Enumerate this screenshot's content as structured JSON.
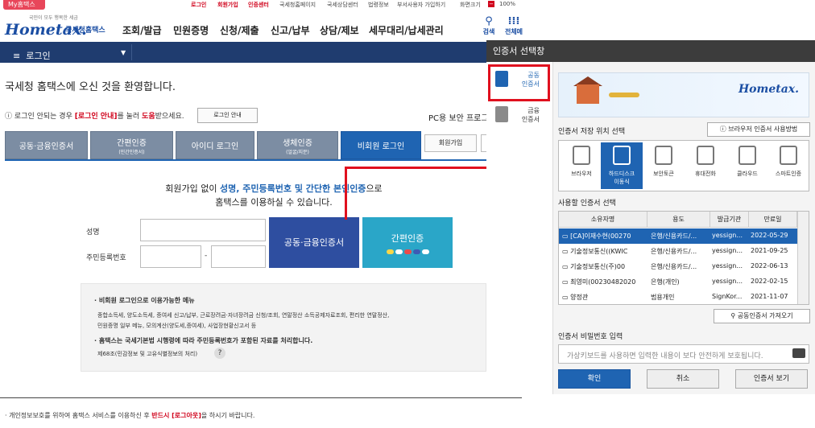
{
  "topbar": {
    "tab": "My홈택스",
    "links": [
      "로그인",
      "회원가입",
      "인증센터",
      "국세청홈페이지",
      "국세상담센터",
      "법령정보",
      "부서사용자 가입하기",
      "화면크기",
      "100%"
    ]
  },
  "header": {
    "logo_main": "Hometax.",
    "logo_sub": "국세청홈택스",
    "logo_tiny": "국민이 모두 행복한 세금",
    "menu": [
      "조회/발급",
      "민원증명",
      "신청/제출",
      "신고/납부",
      "상담/제보",
      "세무대리/납세관리"
    ],
    "search_label": "검색",
    "all_menu_label": "전체메"
  },
  "loginbar": {
    "label": "로그인"
  },
  "main": {
    "welcome": "국세청 홈택스에 오신 것을 환영합니다.",
    "notice_pre": "로그인 안되는 경우 ",
    "notice_link": "[로그인 안내]",
    "notice_mid": "를 눌러 ",
    "notice_help": "도움",
    "notice_post": "받으세요.",
    "notice_button": "로그인 안내",
    "pc_security": "PC용 보안 프로그",
    "tabs": [
      {
        "label": "공동·금융인증서",
        "sub": ""
      },
      {
        "label": "간편인증",
        "sub": "(민간인증서)"
      },
      {
        "label": "아이디 로그인",
        "sub": ""
      },
      {
        "label": "생체인증",
        "sub": "(얼굴/지문)"
      },
      {
        "label": "비회원 로그인",
        "sub": ""
      }
    ],
    "join_button": "회원가입",
    "intro_pre": "회원가입 없이 ",
    "intro_bold": "성명, 주민등록번호 및 간단한 본인인증",
    "intro_post": "으로",
    "intro_line2": "홈택스를 이용하실 수 있습니다.",
    "name_label": "성명",
    "rrn_label": "주민등록번호",
    "rrn_dash": "-",
    "cert_button": "공동·금융인증서",
    "easy_button": "간편인증",
    "info": {
      "title1": "· 비회원 로그인으로 이용가능한 메뉴",
      "line1": "종합소득세, 양도소득세, 증여세 신고/납부, 근로장려금·자녀장려금 신청/조회, 연말정산 소득공제자료조회, 편리한 연말정산,",
      "line2": "민원증명 일부 메뉴, 모의계산(양도세,증여세), 사업장현황신고서 등",
      "title2": "· 홈택스는 국세기본법 시행령에 따라 주민등록번호가 포함된 자료를 처리합니다.",
      "line3": "제68조(민감정보 및 고유식별정보의 처리)",
      "qmark": "?"
    },
    "footnote_pre": "· 개인정보보호를 위하여 홈택스 서비스를 이용하신 후 ",
    "footnote_bold": "반드시 [로그아웃]",
    "footnote_post": "을 하시기 바랍니다."
  },
  "dialog": {
    "title": "인증서 선택창",
    "side_public": [
      "공동",
      "인증서"
    ],
    "side_financial": [
      "금융",
      "인증서"
    ],
    "banner_logo": "Hometax.",
    "location_label": "인증서 저장 위치 선택",
    "browser_help": "브라우저 인증서 사용방법",
    "locations": [
      {
        "label": "브라우저",
        "sub": ""
      },
      {
        "label": "하드디스크",
        "sub": "이동식"
      },
      {
        "label": "보안토큰",
        "sub": ""
      },
      {
        "label": "휴대전화",
        "sub": ""
      },
      {
        "label": "클라우드",
        "sub": ""
      },
      {
        "label": "스마트인증",
        "sub": ""
      }
    ],
    "cert_list_label": "사용할 인증서 선택",
    "columns": [
      "소유자명",
      "용도",
      "발급기관",
      "만료일"
    ],
    "rows": [
      {
        "owner": "[CA]이재수현(00270",
        "usage": "은행/신용카드/...",
        "issuer": "yessign...",
        "expiry": "2022-05-29"
      },
      {
        "owner": "기술정보통신((KWIC",
        "usage": "은행/신용카드/...",
        "issuer": "yessign...",
        "expiry": "2021-09-25"
      },
      {
        "owner": "기술정보통신(주)00",
        "usage": "은행/신용카드/...",
        "issuer": "yessign...",
        "expiry": "2022-06-13"
      },
      {
        "owner": "최영미(00230482020",
        "usage": "은행(개인)",
        "issuer": "yessign...",
        "expiry": "2022-02-15"
      },
      {
        "owner": "양정관",
        "usage": "범용개인",
        "issuer": "SignKor...",
        "expiry": "2021-11-07"
      }
    ],
    "import_button": "공동인증서 가져오기",
    "password_label": "인증서 비밀번호 입력",
    "password_placeholder": "가상키보드를 사용하면 입력한 내용이 보다 안전하게 보호됩니다.",
    "ok": "확인",
    "cancel": "취소",
    "view": "인증서 보기"
  },
  "colors": {
    "brand_blue": "#1f64b2",
    "navy": "#1f3c6f",
    "annotation_red": "#e0101e",
    "tab_gray": "#7c8da3"
  }
}
